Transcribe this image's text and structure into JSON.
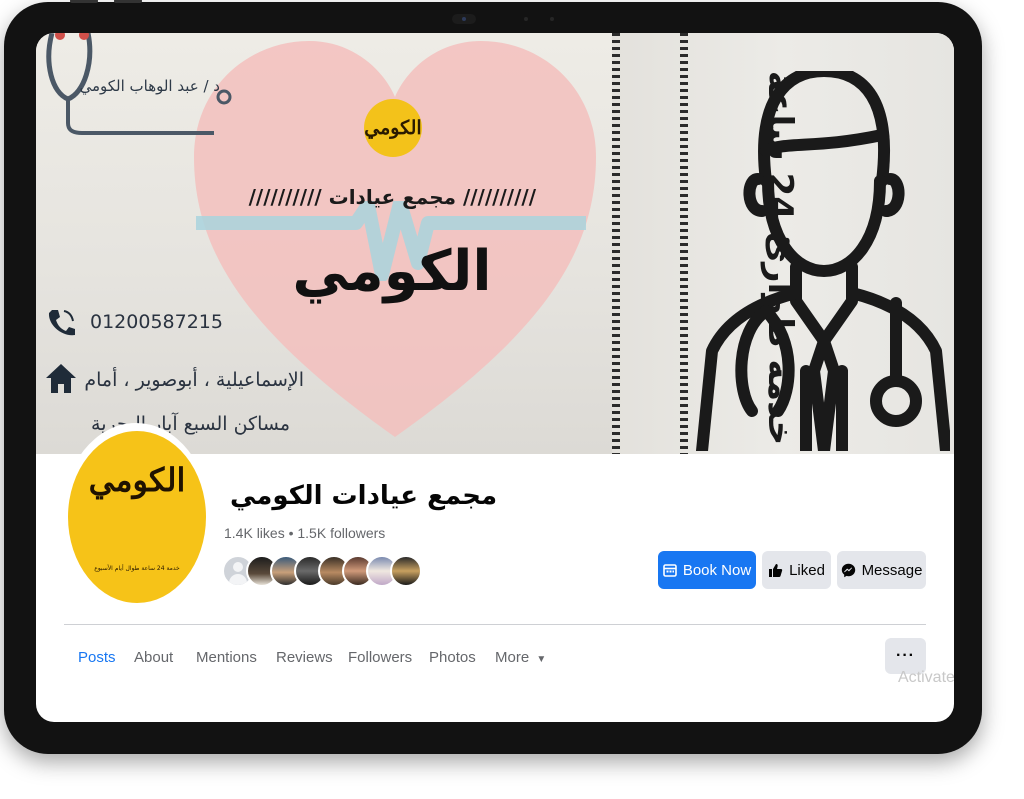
{
  "cover": {
    "doctor_name": "د / عبد الوهاب الكومي",
    "logo_text": "الكومي",
    "complex_line": "////////// مجمع عيادات //////////",
    "clinic_name": "الكومي",
    "phone": "01200587215",
    "address_line1": "الإسماعيلية ، أبوصوير ، أمام",
    "address_line2": "مساكن السبع آبار البحرية",
    "service_text": "خدمة طوارئ 24 ساعة"
  },
  "profile": {
    "logo_text": "الكومي",
    "logo_caption": "خدمة 24 ساعة طوال أيام الأسبوع"
  },
  "page": {
    "name": "مجمع عيادات الكومي",
    "stats": "1.4K likes • 1.5K followers"
  },
  "actions": {
    "book_now": "Book Now",
    "liked": "Liked",
    "message": "Message",
    "more_dots": "···"
  },
  "tabs": {
    "posts": "Posts",
    "about": "About",
    "mentions": "Mentions",
    "reviews": "Reviews",
    "followers": "Followers",
    "photos": "Photos",
    "more": "More"
  },
  "overlay": {
    "activate_text": "Activate"
  },
  "colors": {
    "brand_blue": "#1877f2",
    "button_gray": "#e4e6eb",
    "profile_yellow": "#f6c318"
  }
}
